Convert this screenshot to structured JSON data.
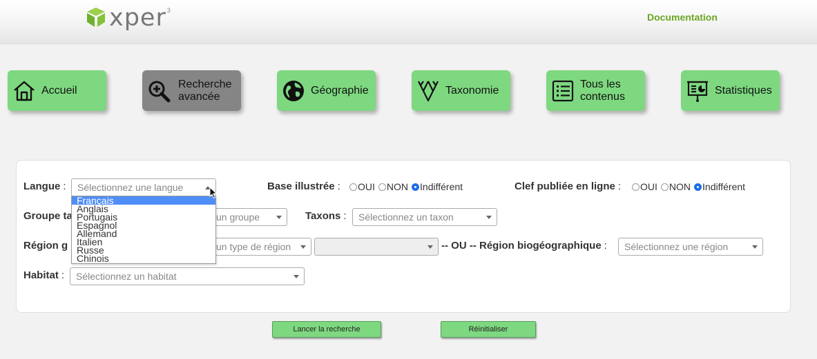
{
  "header": {
    "logo_text": "xper",
    "logo_sup": "3",
    "documentation": "Documentation"
  },
  "nav": [
    {
      "label": "Accueil",
      "icon": "home-icon",
      "active": false
    },
    {
      "label": "Recherche avancée",
      "icon": "zoom-in-icon",
      "active": true
    },
    {
      "label": "Géographie",
      "icon": "globe-icon",
      "active": false
    },
    {
      "label": "Taxonomie",
      "icon": "taxonomy-tree-icon",
      "active": false
    },
    {
      "label": "Tous les contenus",
      "icon": "list-icon",
      "active": false
    },
    {
      "label": "Statistiques",
      "icon": "presentation-chart-icon",
      "active": false
    }
  ],
  "form": {
    "langue": {
      "label": "Langue",
      "placeholder": "Sélectionnez une langue",
      "options": [
        "Français",
        "Anglais",
        "Portugais",
        "Espagnol",
        "Allemand",
        "Italien",
        "Russe",
        "Chinois"
      ],
      "highlighted": "Français"
    },
    "base_illustree": {
      "label": "Base illustrée",
      "options": [
        "OUI",
        "NON",
        "Indifférent"
      ],
      "selected": "Indifférent"
    },
    "clef_publiee": {
      "label": "Clef publiée en ligne",
      "options": [
        "OUI",
        "NON",
        "Indifférent"
      ],
      "selected": "Indifférent"
    },
    "groupe": {
      "label_visible": "Groupe ta",
      "placeholder_visible": "un groupe"
    },
    "taxons": {
      "label": "Taxons",
      "placeholder": "Sélectionnez un taxon"
    },
    "region_g": {
      "label_visible": "Région g",
      "placeholder_visible": "un type de région"
    },
    "ou_label": "-- OU --",
    "region_bio": {
      "label": "Région biogéographique",
      "placeholder": "Sélectionnez une région"
    },
    "habitat": {
      "label": "Habitat",
      "placeholder": "Sélectionnez un habitat"
    }
  },
  "actions": {
    "search": "Lancer la recherche",
    "reset": "Réinitialiser"
  },
  "colors": {
    "nav_green": "#7ed880",
    "nav_active": "#858585",
    "doc_link": "#6aa523",
    "radio_checked": "#1c6fe8",
    "dropdown_highlight": "#4f8ef7"
  }
}
